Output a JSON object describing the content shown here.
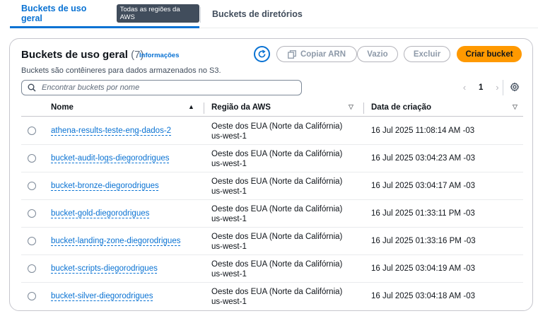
{
  "tabs": {
    "general": "Buckets de uso geral",
    "region_badge": "Todas as regiões da AWS",
    "directory": "Buckets de diretórios"
  },
  "panel": {
    "title": "Buckets de uso geral",
    "count": "(7)",
    "info_link": "Informações",
    "description": "Buckets são contêineres para dados armazenados no S3."
  },
  "toolbar": {
    "copy_arn": "Copiar ARN",
    "empty": "Vazio",
    "delete": "Excluir",
    "create": "Criar bucket"
  },
  "search": {
    "placeholder": "Encontrar buckets por nome"
  },
  "pagination": {
    "page": "1",
    "prev": "‹",
    "next": "›"
  },
  "table": {
    "headers": {
      "name": "Nome",
      "region": "Região da AWS",
      "date": "Data de criação"
    },
    "rows": [
      {
        "name": "athena-results-teste-eng-dados-2",
        "region": "Oeste dos EUA (Norte da Califórnia) us-west-1",
        "date": "16 Jul 2025 11:08:14 AM -03"
      },
      {
        "name": "bucket-audit-logs-diegorodrigues",
        "region": "Oeste dos EUA (Norte da Califórnia) us-west-1",
        "date": "16 Jul 2025 03:04:23 AM -03"
      },
      {
        "name": "bucket-bronze-diegorodrigues",
        "region": "Oeste dos EUA (Norte da Califórnia) us-west-1",
        "date": "16 Jul 2025 03:04:17 AM -03"
      },
      {
        "name": "bucket-gold-diegorodrigues",
        "region": "Oeste dos EUA (Norte da Califórnia) us-west-1",
        "date": "16 Jul 2025 01:33:11 PM -03"
      },
      {
        "name": "bucket-landing-zone-diegorodrigues",
        "region": "Oeste dos EUA (Norte da Califórnia) us-west-1",
        "date": "16 Jul 2025 01:33:16 PM -03"
      },
      {
        "name": "bucket-scripts-diegorodrigues",
        "region": "Oeste dos EUA (Norte da Califórnia) us-west-1",
        "date": "16 Jul 2025 03:04:19 AM -03"
      },
      {
        "name": "bucket-silver-diegorodrigues",
        "region": "Oeste dos EUA (Norte da Califórnia) us-west-1",
        "date": "16 Jul 2025 03:04:18 AM -03"
      }
    ]
  },
  "colors": {
    "accent": "#0972d3",
    "primary_button": "#ff9900",
    "badge_bg": "#414d5c"
  },
  "icons": {
    "refresh": "refresh-icon",
    "copy": "copy-icon",
    "search": "search-icon",
    "settings": "gear-icon",
    "sort": "sort-ascending-icon",
    "filter": "sort-descending-icon"
  }
}
